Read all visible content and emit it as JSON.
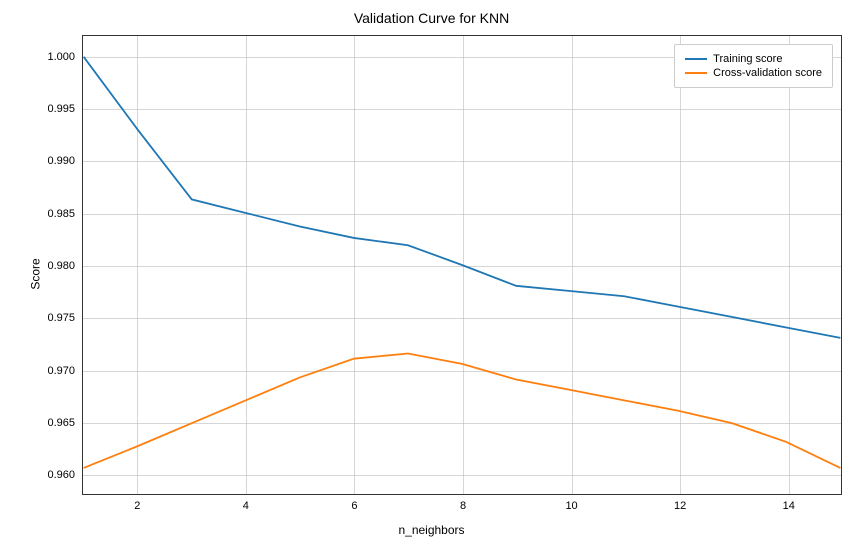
{
  "chart_data": {
    "type": "line",
    "title": "Validation Curve for KNN",
    "xlabel": "n_neighbors",
    "ylabel": "Score",
    "xlim": [
      1,
      15
    ],
    "ylim": [
      0.958,
      1.002
    ],
    "x_ticks": [
      2,
      4,
      6,
      8,
      10,
      12,
      14
    ],
    "y_ticks": [
      0.96,
      0.965,
      0.97,
      0.975,
      0.98,
      0.985,
      0.99,
      0.995,
      1.0
    ],
    "x": [
      1,
      2,
      3,
      4,
      5,
      6,
      7,
      8,
      9,
      10,
      11,
      12,
      13,
      14,
      15
    ],
    "series": [
      {
        "name": "Training score",
        "color": "#1f77b4",
        "values": [
          1.0,
          0.993,
          0.9863,
          0.985,
          0.9837,
          0.9826,
          0.9819,
          0.98,
          0.978,
          0.9775,
          0.977,
          0.976,
          0.975,
          0.974,
          0.973
        ]
      },
      {
        "name": "Cross-validation score",
        "color": "#ff7f0e",
        "values": [
          0.9605,
          0.9626,
          0.9648,
          0.967,
          0.9692,
          0.971,
          0.9715,
          0.9705,
          0.969,
          0.968,
          0.967,
          0.966,
          0.9648,
          0.963,
          0.9605
        ]
      }
    ],
    "legend_position": "upper right",
    "grid": true
  }
}
